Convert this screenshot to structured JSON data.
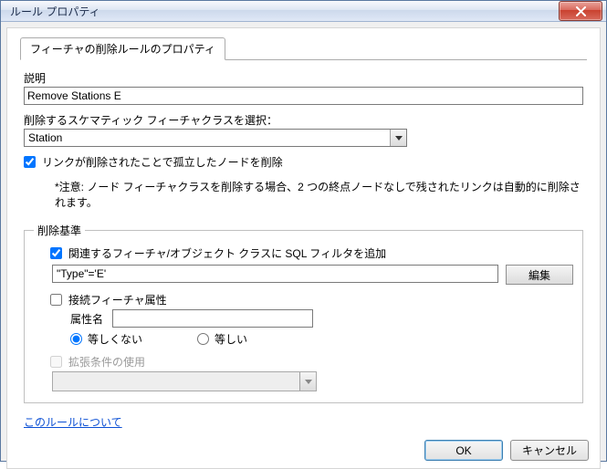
{
  "window": {
    "title": "ルール プロパティ"
  },
  "tab": {
    "label": "フィーチャの削除ルールのプロパティ"
  },
  "desc": {
    "label": "説明",
    "value": "Remove Stations E"
  },
  "featureClass": {
    "label": "削除するスケマティック フィーチャクラスを選択：",
    "selected": "Station"
  },
  "orphan": {
    "label": "リンクが削除されたことで孤立したノードを削除"
  },
  "note": "*注意: ノード フィーチャクラスを削除する場合、2 つの終点ノードなしで残されたリンクは自動的に削除されます。",
  "criteria": {
    "legend": "削除基準",
    "addSql": {
      "label": "関連するフィーチャ/オブジェクト クラスに SQL フィルタを追加"
    },
    "filterValue": "\"Type\"='E'",
    "editBtn": "編集",
    "joinAttr": {
      "label": "接続フィーチャ属性"
    },
    "attrName": {
      "label": "属性名",
      "value": ""
    },
    "radioNotEqual": "等しくない",
    "radioEqual": "等しい",
    "useExt": {
      "label": "拡張条件の使用"
    },
    "extCombo": ""
  },
  "aboutLink": "このルールについて",
  "buttons": {
    "ok": "OK",
    "cancel": "キャンセル"
  }
}
